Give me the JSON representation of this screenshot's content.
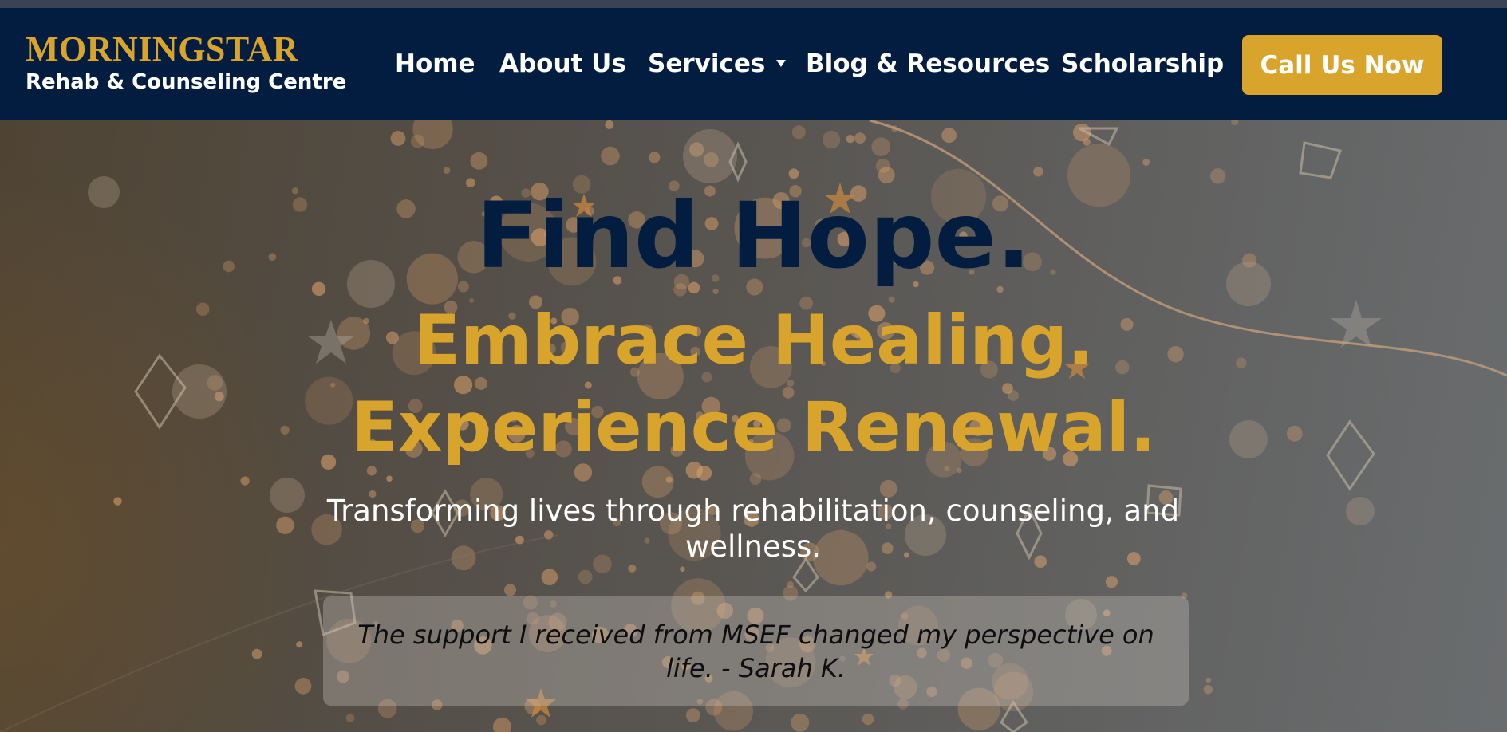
{
  "brand": {
    "name": "MORNINGSTAR",
    "tagline": "Rehab & Counseling Centre",
    "colors": {
      "navy": "#021d40",
      "gold": "#d8a42c",
      "white": "#ffffff"
    }
  },
  "nav": {
    "items": [
      {
        "label": "Home"
      },
      {
        "label": "About Us"
      },
      {
        "label": "Services",
        "icon": "caret-down-icon"
      },
      {
        "label": "Blog & Resources"
      },
      {
        "label": "Scholarship"
      }
    ],
    "cta_label": "Call Us Now"
  },
  "hero": {
    "headline": "Find Hope.",
    "subheadline_1": "Embrace Healing.",
    "subheadline_2": "Experience Renewal.",
    "description": "Transforming lives through rehabilitation, counseling, and wellness.",
    "testimonial": "The support I received from MSEF changed my perspective on life. - Sarah K."
  }
}
